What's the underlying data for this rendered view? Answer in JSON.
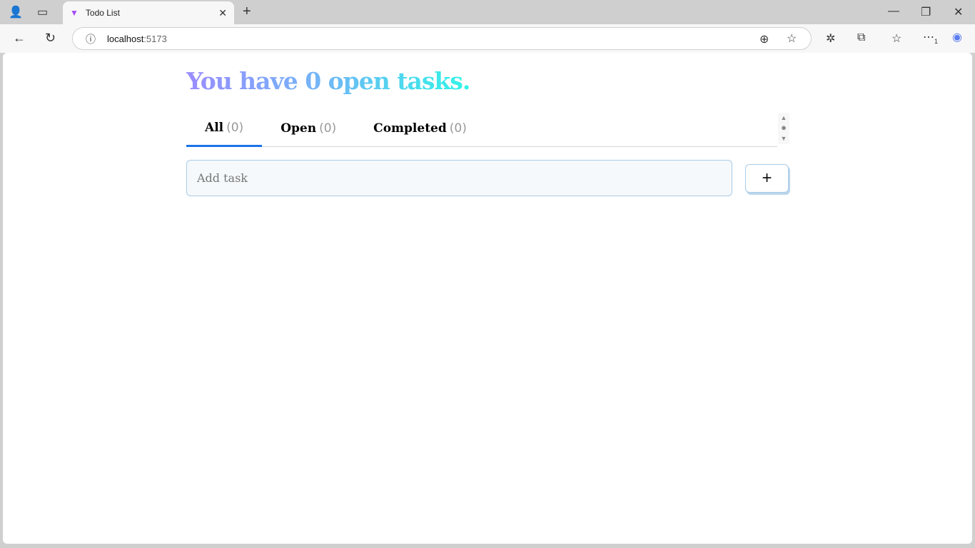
{
  "browser": {
    "tab_title": "Todo List",
    "url_host": "localhost",
    "url_port": ":5173",
    "notification_badge": "1"
  },
  "app": {
    "heading": "You have 0 open tasks.",
    "tabs": [
      {
        "label": "All",
        "count": "(0)"
      },
      {
        "label": "Open",
        "count": "(0)"
      },
      {
        "label": "Completed",
        "count": "(0)"
      }
    ],
    "active_tab": "All",
    "input_placeholder": "Add task",
    "add_button": "+",
    "colors": {
      "accent": "#1a73e8",
      "gradient_start": "#9a8cff",
      "gradient_end": "#30f5e8"
    }
  }
}
